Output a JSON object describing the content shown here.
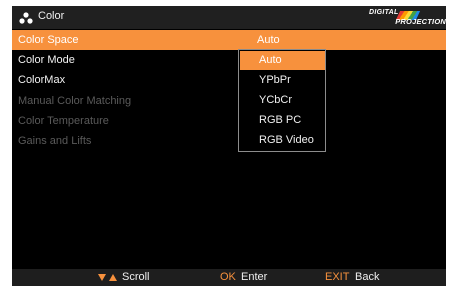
{
  "header": {
    "title": "Color",
    "icon": "color-dots-icon",
    "logo_top": "DIGITAL",
    "logo_bottom": "PROJECTION"
  },
  "menu": [
    {
      "label": "Color Space",
      "value": "Auto",
      "state": "active"
    },
    {
      "label": "Color Mode",
      "value": "",
      "state": "enabled"
    },
    {
      "label": "ColorMax",
      "value": "",
      "state": "enabled"
    },
    {
      "label": "Manual Color Matching",
      "value": "",
      "state": "disabled"
    },
    {
      "label": "Color Temperature",
      "value": "",
      "state": "disabled"
    },
    {
      "label": "Gains and Lifts",
      "value": "",
      "state": "disabled"
    }
  ],
  "dropdown": {
    "options": [
      "Auto",
      "YPbPr",
      "YCbCr",
      "RGB PC",
      "RGB Video"
    ],
    "selected": "Auto"
  },
  "footer": {
    "scroll_icon": "up-down-arrows-icon",
    "scroll_label": "Scroll",
    "ok_key": "OK",
    "ok_label": "Enter",
    "exit_key": "EXIT",
    "exit_label": "Back"
  },
  "colors": {
    "accent": "#f7913d",
    "background": "#000000",
    "disabled": "#5a5a5a"
  }
}
